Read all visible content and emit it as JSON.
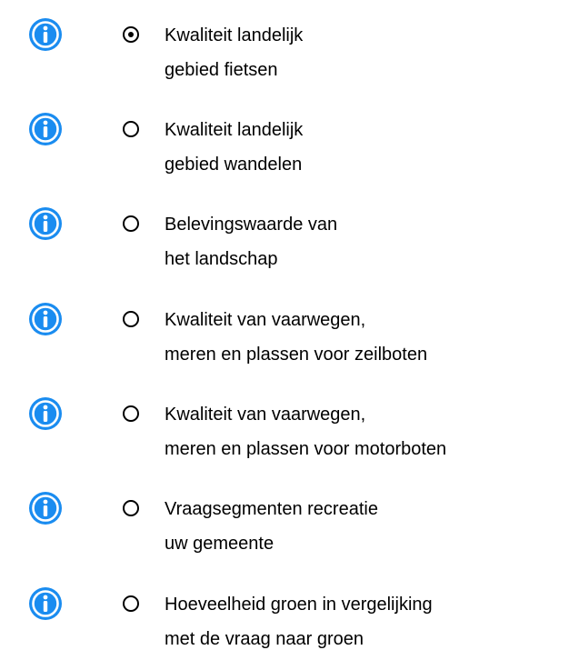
{
  "colors": {
    "info_icon": "#1a8cf0",
    "text": "#000000"
  },
  "options": [
    {
      "line1": "Kwaliteit landelijk",
      "line2": "gebied fietsen",
      "selected": true,
      "icon": "info-icon"
    },
    {
      "line1": "Kwaliteit landelijk",
      "line2": "gebied wandelen",
      "selected": false,
      "icon": "info-icon"
    },
    {
      "line1": "Belevingswaarde van",
      "line2": "het landschap",
      "selected": false,
      "icon": "info-icon"
    },
    {
      "line1": "Kwaliteit van vaarwegen,",
      "line2": "meren en plassen voor zeilboten",
      "selected": false,
      "icon": "info-icon"
    },
    {
      "line1": "Kwaliteit van vaarwegen,",
      "line2": "meren en plassen voor motorboten",
      "selected": false,
      "icon": "info-icon"
    },
    {
      "line1": "Vraagsegmenten recreatie",
      "line2": "uw gemeente",
      "selected": false,
      "icon": "info-icon"
    },
    {
      "line1": "Hoeveelheid groen in vergelijking",
      "line2": "met de vraag naar groen",
      "selected": false,
      "icon": "info-icon"
    }
  ]
}
